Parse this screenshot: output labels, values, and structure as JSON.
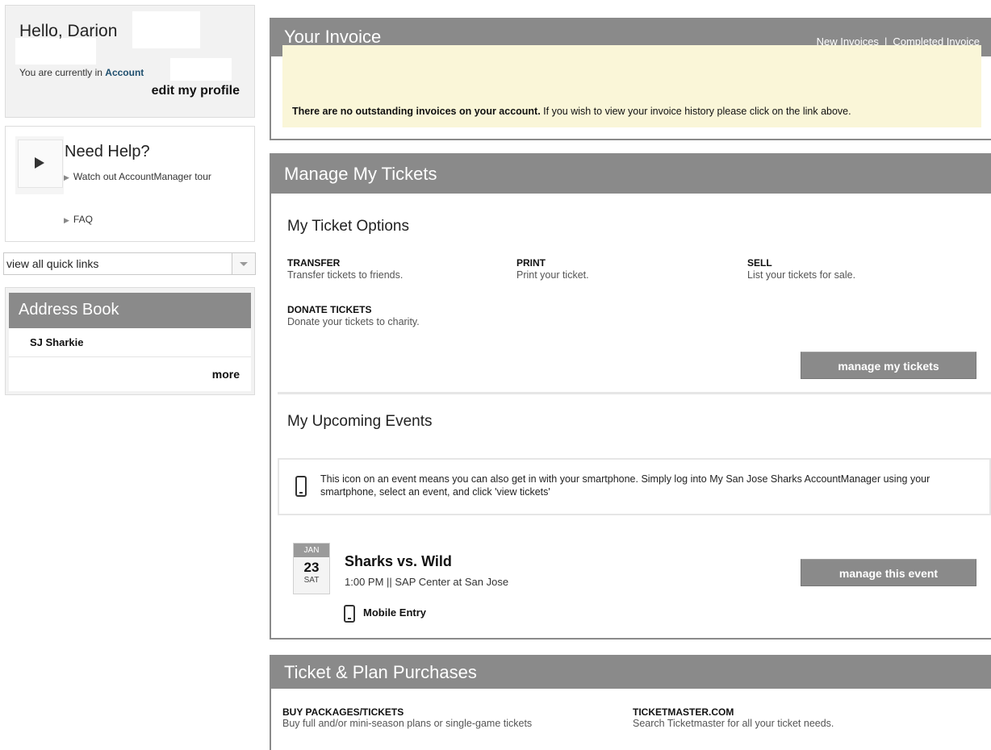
{
  "user": {
    "greeting": "Hello, Darion",
    "location_prefix": "You are currently in ",
    "location": "Account",
    "edit_profile": "edit my profile"
  },
  "help": {
    "title": "Need Help?",
    "tour_link": "Watch out AccountManager tour",
    "faq_link": "FAQ"
  },
  "quick_links": {
    "selected": "view all quick links"
  },
  "address_book": {
    "title": "Address Book",
    "contacts": [
      "SJ Sharkie"
    ],
    "more": "more"
  },
  "invoice": {
    "title": "Your Invoice",
    "link_new": "New Invoices",
    "separator": "|",
    "link_completed": "Completed Invoice",
    "notice_bold": "There are no outstanding invoices on your account.",
    "notice_rest": " If you wish to view your invoice history please click on the link above."
  },
  "manage": {
    "title": "Manage My Tickets",
    "options_heading": "My Ticket Options",
    "options": [
      {
        "title": "TRANSFER",
        "desc": "Transfer tickets to friends."
      },
      {
        "title": "PRINT",
        "desc": "Print your ticket."
      },
      {
        "title": "SELL",
        "desc": "List your tickets for sale."
      },
      {
        "title": "DONATE TICKETS",
        "desc": "Donate your tickets to charity."
      }
    ],
    "manage_button": "manage my tickets",
    "events_heading": "My Upcoming Events",
    "smartphone_notice": "This icon on an event means you can also get in with your smartphone. Simply log into My San Jose Sharks AccountManager using your smartphone, select an event, and click 'view tickets'",
    "event": {
      "month": "JAN",
      "day": "23",
      "weekday": "SAT",
      "title": "Sharks vs. Wild",
      "info": "1:00 PM || SAP Center at San Jose",
      "mobile": "Mobile Entry",
      "button": "manage this event"
    }
  },
  "purchases": {
    "title": "Ticket & Plan Purchases",
    "items": [
      {
        "title": "BUY PACKAGES/TICKETS",
        "desc": "Buy full and/or mini-season plans or single-game tickets"
      },
      {
        "title": "TICKETMASTER.COM",
        "desc": "Search Ticketmaster for all your ticket needs."
      }
    ]
  }
}
